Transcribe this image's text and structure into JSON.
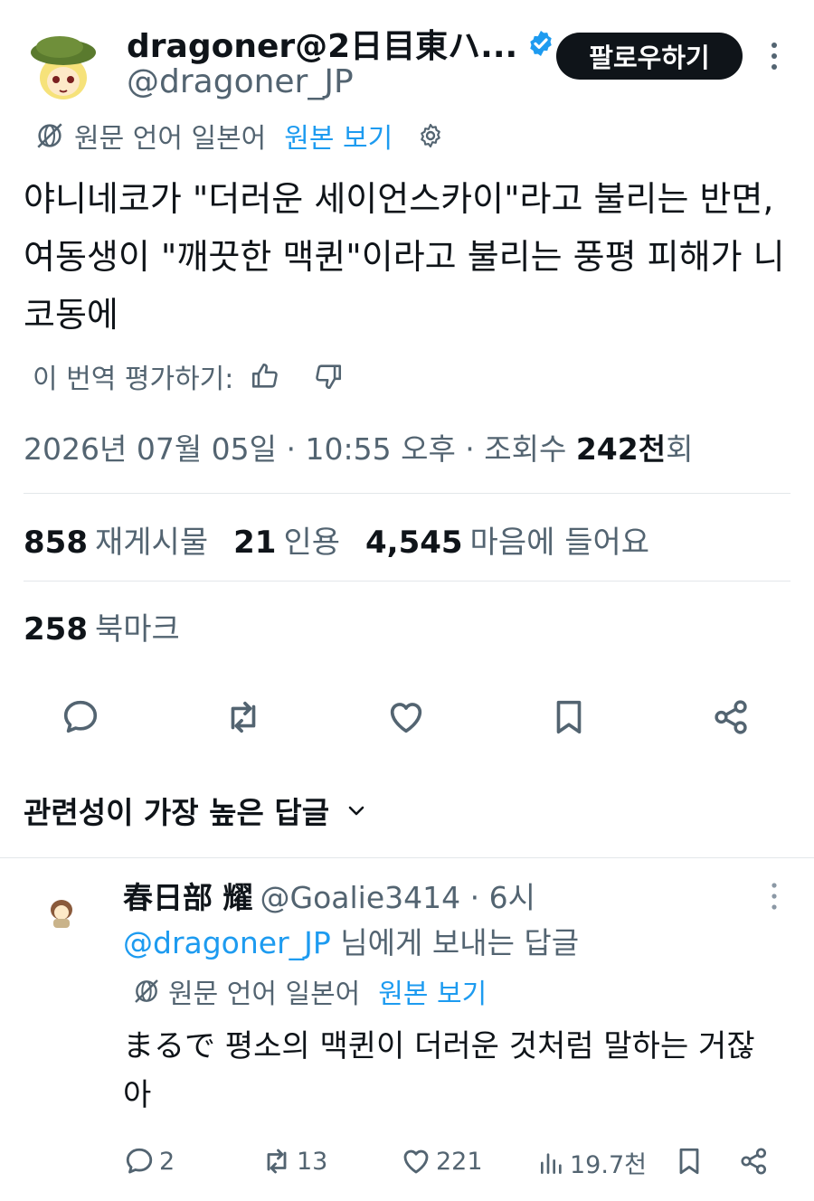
{
  "tweet": {
    "display_name": "dragoner@2日目東ハ...",
    "handle": "@dragoner_JP",
    "follow_label": "팔로우하기",
    "translate": {
      "label": "원문 언어 일본어",
      "link": "원본 보기"
    },
    "text": "야니네코가 \"더러운 세이언스카이\"라고 불리는 반면, 여동생이 \"깨끗한 맥퀸\"이라고 불리는 풍평 피해가 니코동에",
    "rate_label": "이 번역 평가하기:",
    "meta": {
      "date": "2026년 07월 05일 · 10:55 오후 · 조회수 ",
      "views": "242천",
      "views_suffix": "회"
    },
    "stats": [
      {
        "count": "858",
        "label": "재게시물"
      },
      {
        "count": "21",
        "label": "인용"
      },
      {
        "count": "4,545",
        "label": "마음에 들어요"
      }
    ],
    "bookmarks": {
      "count": "258",
      "label": "북마크"
    }
  },
  "replies_sort": {
    "label": "관련성이 가장 높은 답글"
  },
  "reply": {
    "display_name": "春日部 耀",
    "handle_time": "@Goalie3414 · 6시",
    "reply_to_handle": "@dragoner_JP",
    "reply_to_suffix": " 님에게 보내는 답글",
    "translate": {
      "label": "원문 언어 일본어",
      "link": "원본 보기"
    },
    "text": "まるで 평소의 맥퀸이 더러운 것처럼 말하는 거잖아",
    "actions": {
      "replies": "2",
      "reposts": "13",
      "likes": "221",
      "views": "19.7천"
    }
  },
  "colors": {
    "accent": "#1d9bf0",
    "text": "#0f1419",
    "muted": "#536471",
    "divider": "#e3e7ea"
  }
}
